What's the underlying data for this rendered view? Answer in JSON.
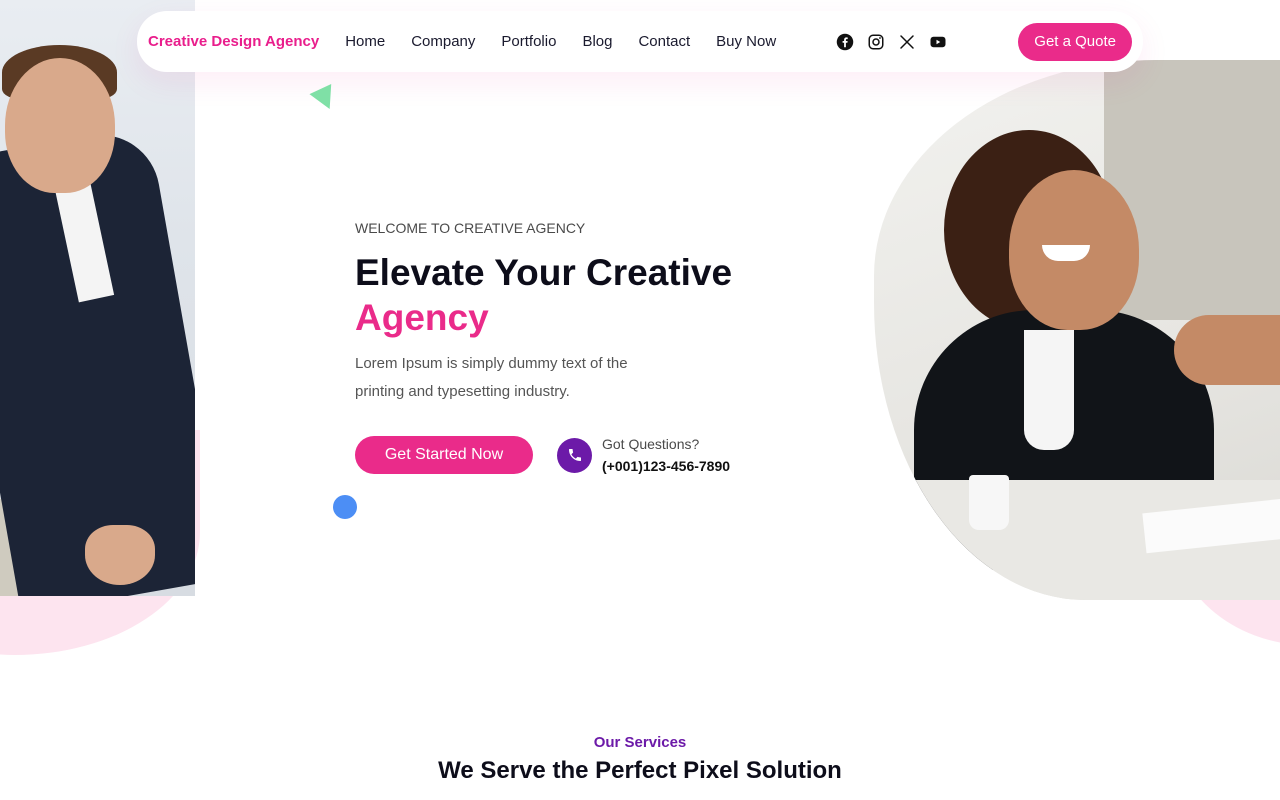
{
  "header": {
    "logo": "Creative Design Agency",
    "nav": [
      "Home",
      "Company",
      "Portfolio",
      "Blog",
      "Contact",
      "Buy Now"
    ],
    "socials": [
      "facebook-icon",
      "instagram-icon",
      "x-icon",
      "youtube-icon"
    ],
    "cta_label": "Get a Quote"
  },
  "hero": {
    "eyebrow": "WELCOME TO CREATIVE AGENCY",
    "title_line1": "Elevate Your Creative",
    "title_line2": "Agency",
    "description": "Lorem Ipsum is simply dummy text of the printing and typesetting industry.",
    "start_label": "Get Started Now",
    "phone_question": "Got Questions?",
    "phone_number": "(+001)123-456-7890"
  },
  "services": {
    "eyebrow": "Our Services",
    "title": "We Serve the Perfect Pixel Solution"
  },
  "colors": {
    "accent": "#ea2b8a",
    "purple": "#6c1aa8",
    "dot_blue": "#4c8ef5",
    "triangle_green": "#7fe0a6",
    "blob_pink": "#fde4ef"
  }
}
